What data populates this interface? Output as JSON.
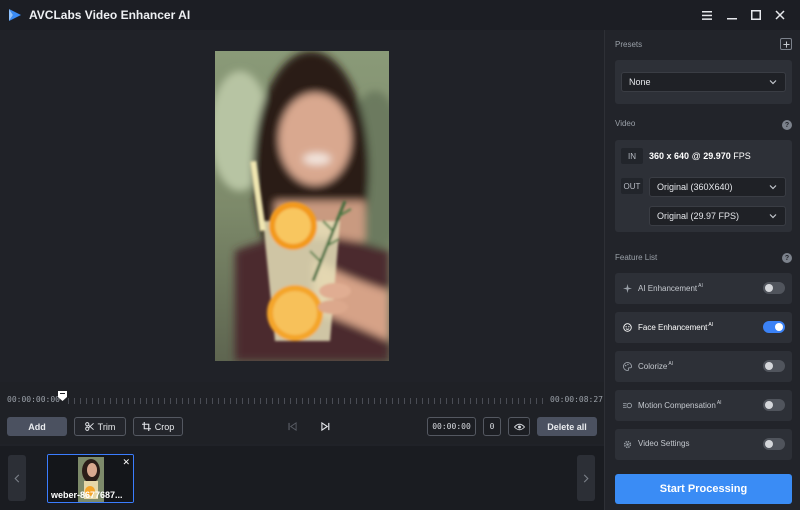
{
  "app": {
    "title": "AVCLabs Video Enhancer AI"
  },
  "window_controls": {
    "menu_icon": "hamburger-icon",
    "minimize_icon": "minimize-icon",
    "maximize_icon": "maximize-icon",
    "close_icon": "close-icon"
  },
  "timeline": {
    "start_time": "00:00:00:00",
    "end_time": "00:00:08:27"
  },
  "controls": {
    "add_label": "Add",
    "trim_label": "Trim",
    "crop_label": "Crop",
    "time_value": "00:00:00",
    "frame_value": "0",
    "delete_all_label": "Delete all"
  },
  "filmstrip": {
    "clips": [
      {
        "name": "weber-8677687..."
      }
    ]
  },
  "presets": {
    "label": "Presets",
    "selected": "None"
  },
  "video": {
    "label": "Video",
    "in_label": "IN",
    "in_resolution": "360 x 640",
    "in_at": "@",
    "in_fps_value": "29.970",
    "in_fps_unit": "FPS",
    "out_label": "OUT",
    "out_resolution_selected": "Original (360X640)",
    "out_fps_selected": "Original (29.97 FPS)"
  },
  "features": {
    "label": "Feature List",
    "items": [
      {
        "label": "AI Enhancement",
        "sup": "AI",
        "enabled": false,
        "icon": "sparkle-icon"
      },
      {
        "label": "Face Enhancement",
        "sup": "AI",
        "enabled": true,
        "icon": "face-icon"
      },
      {
        "label": "Colorize",
        "sup": "AI",
        "enabled": false,
        "icon": "palette-icon"
      },
      {
        "label": "Motion Compensation",
        "sup": "AI",
        "enabled": false,
        "icon": "motion-icon"
      },
      {
        "label": "Video Settings",
        "sup": "",
        "enabled": false,
        "icon": "gear-icon"
      }
    ]
  },
  "start_button": {
    "label": "Start Processing"
  },
  "colors": {
    "accent": "#3a8cf5",
    "background": "#1c1e24",
    "panel": "#2d3037"
  }
}
